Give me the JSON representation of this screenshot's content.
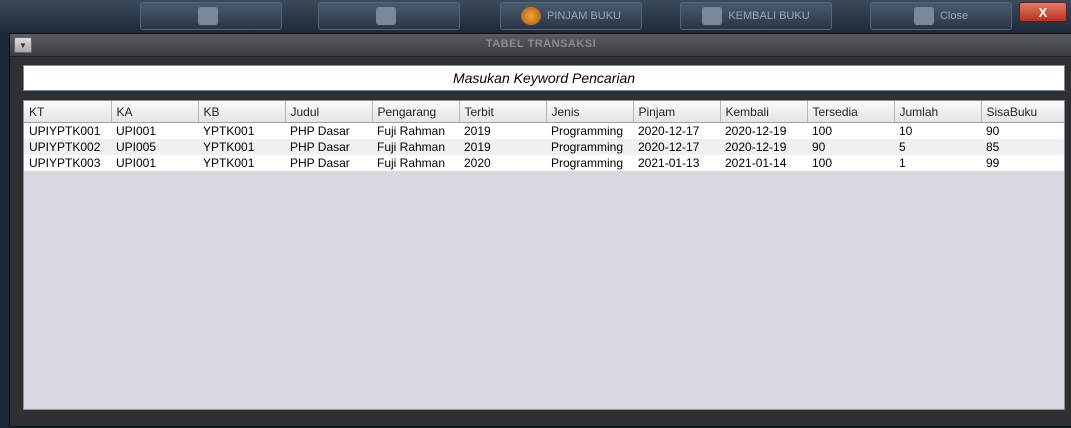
{
  "background_app": {
    "items": [
      {
        "label": "",
        "icon": "user-icon"
      },
      {
        "label": "",
        "icon": "document-icon"
      },
      {
        "label": "PINJAM BUKU",
        "icon": "book-icon"
      },
      {
        "label": "KEMBALI BUKU",
        "icon": "return-icon"
      },
      {
        "label": "Close",
        "icon": "exit-icon"
      }
    ],
    "close_label": "X"
  },
  "window": {
    "title": "TABEL TRANSAKSI",
    "menu_glyph": "▼"
  },
  "search": {
    "value": "Masukan Keyword Pencarian"
  },
  "table": {
    "columns": [
      "KT",
      "KA",
      "KB",
      "Judul",
      "Pengarang",
      "Terbit",
      "Jenis",
      "Pinjam",
      "Kembali",
      "Tersedia",
      "Jumlah",
      "SisaBuku"
    ],
    "rows": [
      [
        "UPIYPTK001",
        "UPI001",
        "YPTK001",
        "PHP Dasar",
        "Fuji Rahman",
        "2019",
        "Programming",
        "2020-12-17",
        "2020-12-19",
        "100",
        "10",
        "90"
      ],
      [
        "UPIYPTK002",
        "UPI005",
        "YPTK001",
        "PHP Dasar",
        "Fuji Rahman",
        "2019",
        "Programming",
        "2020-12-17",
        "2020-12-19",
        "90",
        "5",
        "85"
      ],
      [
        "UPIYPTK003",
        "UPI001",
        "YPTK001",
        "PHP Dasar",
        "Fuji Rahman",
        "2020",
        "Programming",
        "2021-01-13",
        "2021-01-14",
        "100",
        "1",
        "99"
      ]
    ]
  },
  "colors": {
    "accent_close": "#c0392b",
    "table_bg": "#d6d9e0"
  }
}
